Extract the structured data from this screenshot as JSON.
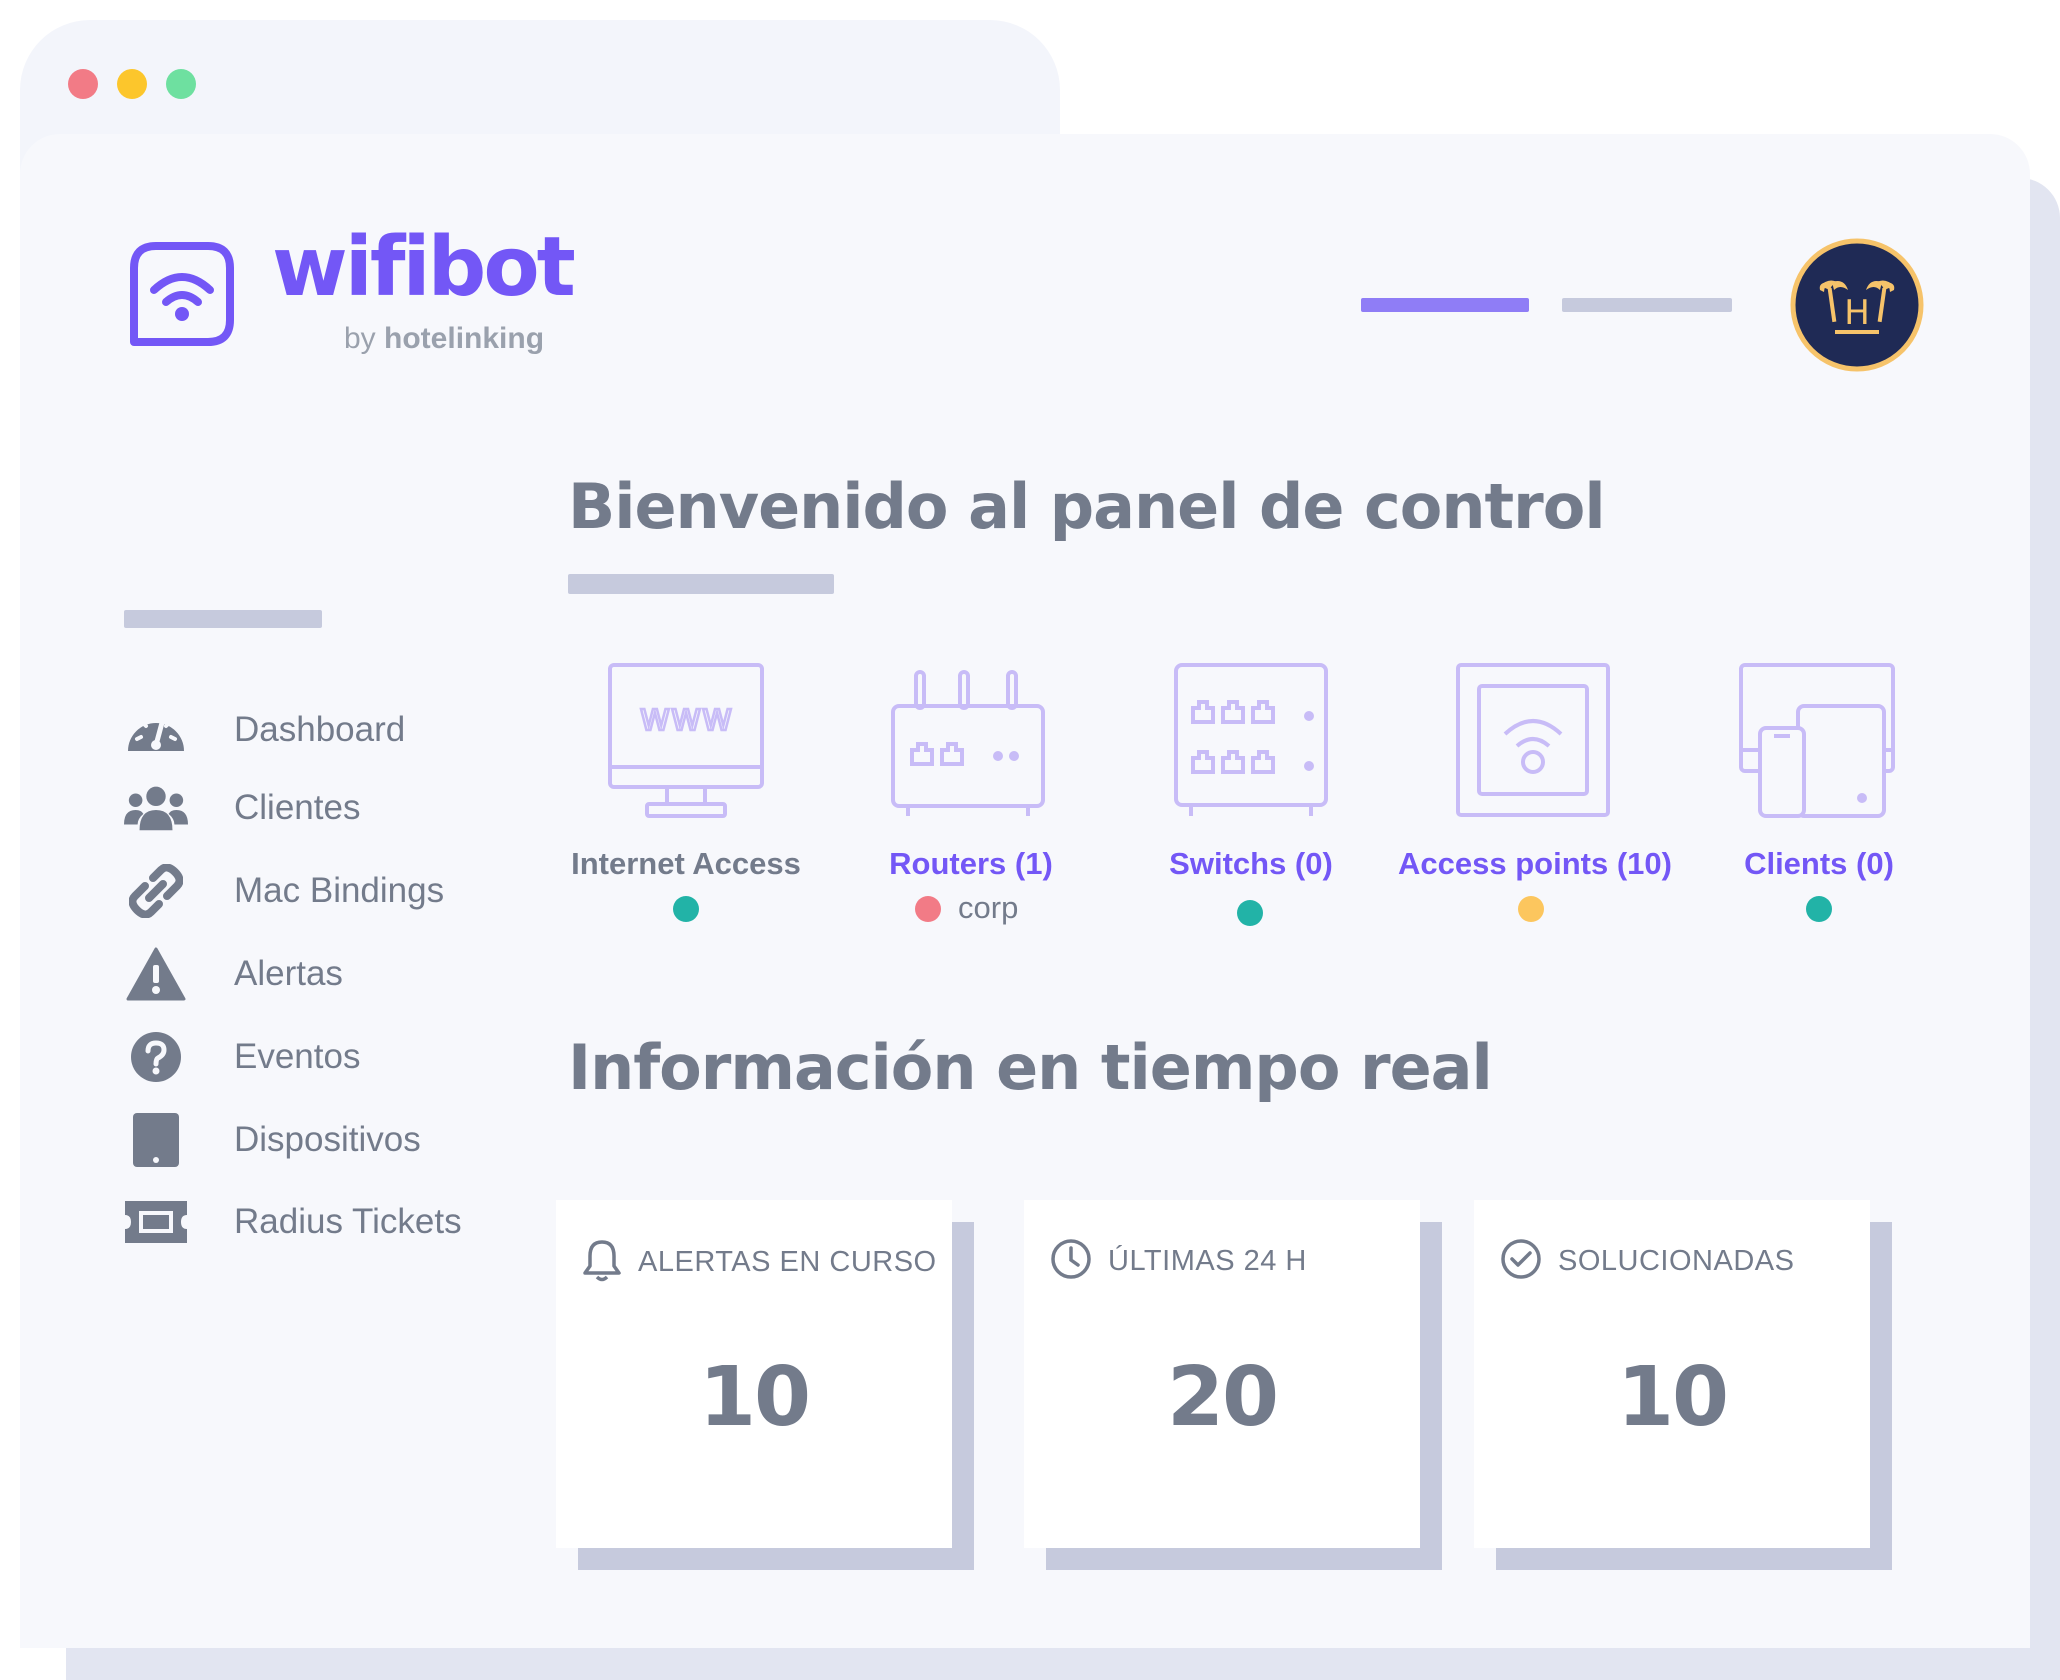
{
  "window_controls": {
    "close_color": "#f27b86",
    "minimize_color": "#fcc62c",
    "maximize_color": "#6ee0a0"
  },
  "brand": {
    "name": "wifibot",
    "by_prefix": "by",
    "by_name": "hotelinking",
    "color": "#7357f6"
  },
  "avatar": {
    "letter": "H",
    "background": "#1f2a55",
    "accent": "#f6c36a",
    "icon": "palm-hotel-logo"
  },
  "sidebar": {
    "items": [
      {
        "label": "Dashboard",
        "icon": "speedometer-icon"
      },
      {
        "label": "Clientes",
        "icon": "users-icon"
      },
      {
        "label": "Mac Bindings",
        "icon": "link-icon"
      },
      {
        "label": "Alertas",
        "icon": "warning-icon"
      },
      {
        "label": "Eventos",
        "icon": "question-icon"
      },
      {
        "label": "Dispositivos",
        "icon": "tablet-icon"
      },
      {
        "label": "Radius Tickets",
        "icon": "ticket-icon"
      }
    ]
  },
  "main": {
    "welcome_title": "Bienvenido al panel de control",
    "realtime_title": "Información en tiempo real",
    "devices": [
      {
        "label": "Internet Access",
        "icon": "monitor-www-icon",
        "status_color": "#22b3a7",
        "sub": ""
      },
      {
        "label": "Routers (1)",
        "icon": "router-icon",
        "status_color": "#f27b86",
        "sub": "corp"
      },
      {
        "label": "Switchs (0)",
        "icon": "switch-icon",
        "status_color": "#22b3a7",
        "sub": ""
      },
      {
        "label": "Access points (10)",
        "icon": "access-point-icon",
        "status_color": "#fcc65e",
        "sub": ""
      },
      {
        "label": "Clients (0)",
        "icon": "devices-icon",
        "status_color": "#22b3a7",
        "sub": ""
      }
    ],
    "cards": [
      {
        "title": "ALERTAS EN CURSO",
        "value": "10",
        "icon": "bell-icon"
      },
      {
        "title": "ÚLTIMAS 24 H",
        "value": "20",
        "icon": "clock-icon"
      },
      {
        "title": "SOLUCIONADAS",
        "value": "10",
        "icon": "check-circle-icon"
      }
    ]
  },
  "colors": {
    "text_gray": "#737b8b",
    "purple_accent": "#7357f6",
    "icon_lavender": "#c8bcf7",
    "placeholder_bar": "#c6cadd"
  }
}
